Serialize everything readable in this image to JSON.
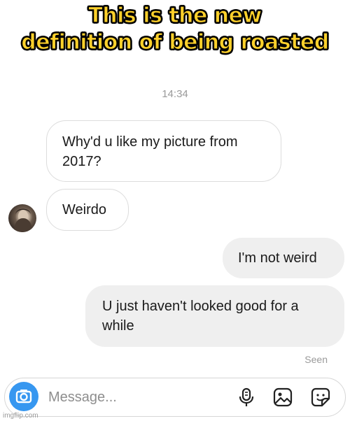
{
  "meme": {
    "caption_line1": "This is the new",
    "caption_line2": "definition of being roasted",
    "caption_color": "#ffd12b"
  },
  "chat": {
    "timestamp": "14:34",
    "messages": [
      {
        "direction": "incoming",
        "text_line1": "Why'd u like my picture from",
        "text_line2": "2017?"
      },
      {
        "direction": "incoming",
        "text": "Weirdo",
        "show_avatar": true
      },
      {
        "direction": "outgoing",
        "text": "I'm not weird"
      },
      {
        "direction": "outgoing",
        "text_line1": "U just haven't looked good for a",
        "text_line2": "while"
      }
    ],
    "seen_label": "Seen"
  },
  "composer": {
    "placeholder": "Message...",
    "icons": [
      "camera-icon",
      "microphone-icon",
      "gallery-icon",
      "sticker-icon"
    ],
    "accent_color": "#3797f0"
  },
  "watermark": "imgflip.com"
}
